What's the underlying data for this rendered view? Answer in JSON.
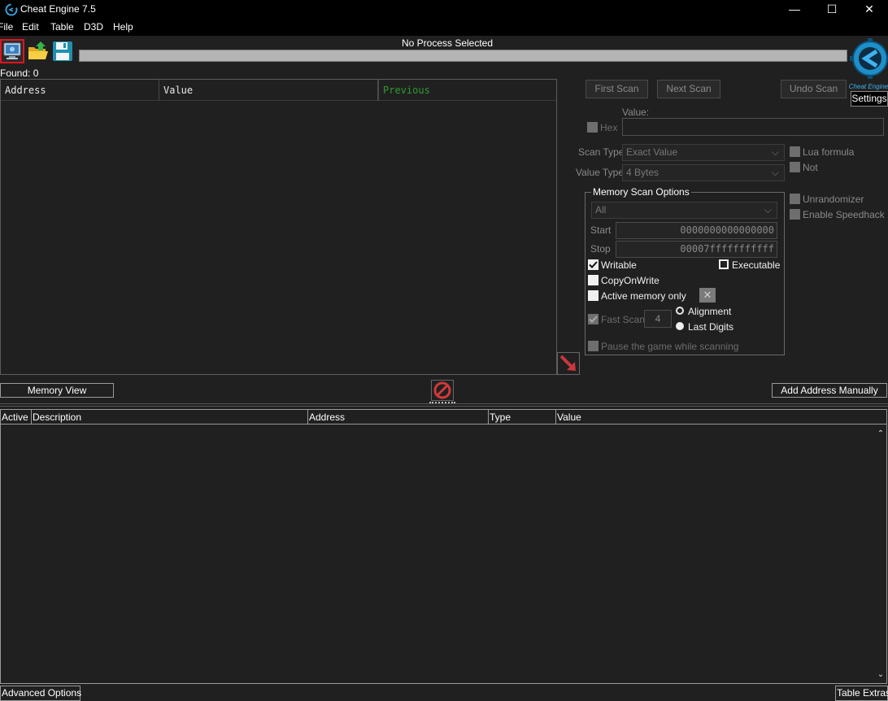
{
  "window": {
    "title": "Cheat Engine 7.5",
    "minimize_glyph": "—",
    "maximize_glyph": "☐",
    "close_glyph": "✕"
  },
  "menu": {
    "file": "File",
    "edit": "Edit",
    "table": "Table",
    "d3d": "D3D",
    "help": "Help"
  },
  "toolbar": {
    "process_label": "No Process Selected",
    "settings_label": "Settings",
    "icons": [
      "computer-icon",
      "open-folder-icon",
      "save-floppy-icon"
    ]
  },
  "found": {
    "label": "Found: 0"
  },
  "found_list": {
    "columns": [
      "Address",
      "Value",
      "Previous"
    ],
    "rows": []
  },
  "scan": {
    "first_scan": "First Scan",
    "next_scan": "Next Scan",
    "undo_scan": "Undo Scan",
    "value_label": "Value:",
    "hex_label": "Hex",
    "value": "",
    "scan_type_label": "Scan Type",
    "scan_type_value": "Exact Value",
    "value_type_label": "Value Type",
    "value_type_value": "4 Bytes",
    "lua_formula": "Lua formula",
    "not_label": "Not",
    "unrandomizer": "Unrandomizer",
    "enable_speedhack": "Enable Speedhack"
  },
  "memory_scan_options": {
    "title": "Memory Scan Options",
    "region_value": "All",
    "start_label": "Start",
    "start_value": "0000000000000000",
    "stop_label": "Stop",
    "stop_value": "00007fffffffffff",
    "writable": "Writable",
    "executable": "Executable",
    "copy_on_write": "CopyOnWrite",
    "active_memory_only": "Active memory only",
    "fast_scan": "Fast Scan",
    "fast_scan_value": "4",
    "alignment": "Alignment",
    "last_digits": "Last Digits",
    "pause_game": "Pause the game while scanning"
  },
  "buttons": {
    "memory_view": "Memory View",
    "add_address_manually": "Add Address Manually",
    "advanced_options": "Advanced Options",
    "table_extras": "Table Extras"
  },
  "address_table": {
    "columns": [
      "Active",
      "Description",
      "Address",
      "Type",
      "Value"
    ],
    "rows": []
  },
  "colors": {
    "background": "#202020",
    "titlebar": "#000000",
    "previous_column": "#2f9a2f",
    "highlight_border": "#e0141e",
    "logo_blue": "#1e8fc8"
  }
}
